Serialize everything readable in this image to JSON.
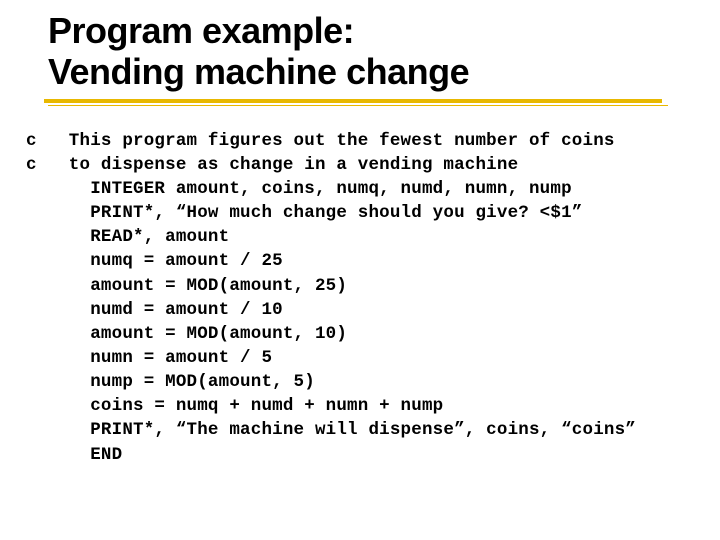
{
  "title_line1": "Program example:",
  "title_line2": "Vending machine change",
  "code": "c   This program figures out the fewest number of coins\nc   to dispense as change in a vending machine\n      INTEGER amount, coins, numq, numd, numn, nump\n      PRINT*, “How much change should you give? <$1”\n      READ*, amount\n      numq = amount / 25\n      amount = MOD(amount, 25)\n      numd = amount / 10\n      amount = MOD(amount, 10)\n      numn = amount / 5\n      nump = MOD(amount, 5)\n      coins = numq + numd + numn + nump\n      PRINT*, “The machine will dispense”, coins, “coins”\n      END"
}
